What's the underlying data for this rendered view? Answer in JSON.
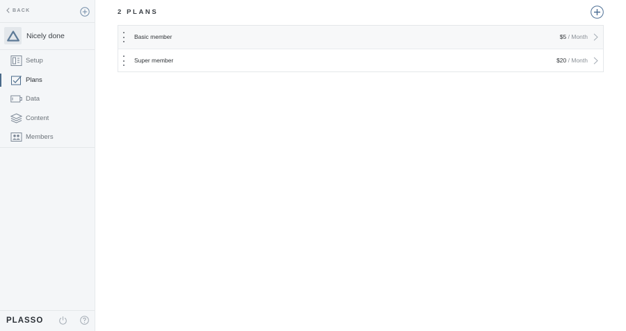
{
  "sidebar": {
    "back_label": "BACK",
    "account_name": "Nicely done",
    "items": [
      {
        "label": "Setup",
        "icon": "setup-icon",
        "active": false
      },
      {
        "label": "Plans",
        "icon": "plans-icon",
        "active": true
      },
      {
        "label": "Data",
        "icon": "data-icon",
        "active": false
      },
      {
        "label": "Content",
        "icon": "content-icon",
        "active": false
      },
      {
        "label": "Members",
        "icon": "members-icon",
        "active": false
      }
    ],
    "brand": "PLASSO"
  },
  "main": {
    "title": "2 PLANS",
    "plans": [
      {
        "name": "Basic member",
        "price": "$5",
        "separator": "/",
        "period": "Month"
      },
      {
        "name": "Super member",
        "price": "$20",
        "separator": "/",
        "period": "Month"
      }
    ]
  },
  "colors": {
    "sidebar_bg": "#f4f6f8",
    "accent": "#4a6a8a",
    "text": "#2f3337",
    "muted": "#8a9097"
  }
}
